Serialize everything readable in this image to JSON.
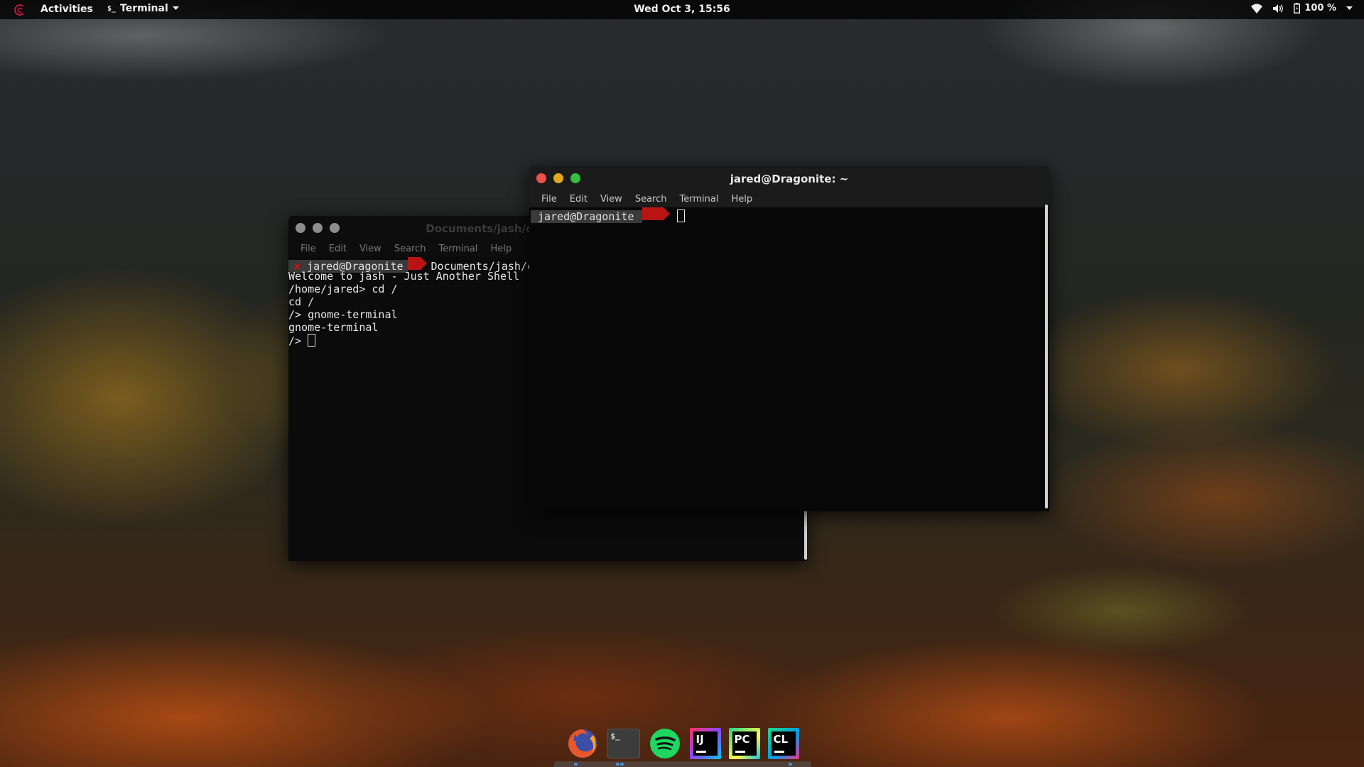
{
  "topbar": {
    "activities": "Activities",
    "app_menu": "Terminal",
    "clock": "Wed Oct  3, 15:56",
    "battery": "100 %",
    "icons": [
      "debian-logo-icon",
      "wifi-icon",
      "volume-icon",
      "battery-icon",
      "chevron-down-icon"
    ]
  },
  "back_window": {
    "title": "Documents/jash/cmake-build-debug/jash",
    "menu": [
      "File",
      "Edit",
      "View",
      "Search",
      "Terminal",
      "Help"
    ],
    "prompt": {
      "status": "✘",
      "user_host": "jared@Dragonite",
      "path": "Documents/jash/cmake-build-debug/jash"
    },
    "lines": [
      "Welcome to jash - Just Another Shell",
      "/home/jared> cd /",
      "cd /",
      "/> gnome-terminal",
      "gnome-terminal",
      "/> "
    ]
  },
  "front_window": {
    "title": "jared@Dragonite: ~",
    "menu": [
      "File",
      "Edit",
      "View",
      "Search",
      "Terminal",
      "Help"
    ],
    "prompt": {
      "user_host": "jared@Dragonite"
    }
  },
  "dock": {
    "apps": [
      {
        "name": "Firefox",
        "icon": "firefox-icon"
      },
      {
        "name": "Terminal",
        "icon": "terminal-icon",
        "label": "$_"
      },
      {
        "name": "Spotify",
        "icon": "spotify-icon"
      },
      {
        "name": "IntelliJ IDEA",
        "icon": "intellij-icon",
        "label": "IJ"
      },
      {
        "name": "PyCharm",
        "icon": "pycharm-icon",
        "label": "PC"
      },
      {
        "name": "CLion",
        "icon": "clion-icon",
        "label": "CL"
      }
    ]
  },
  "colors": {
    "powerline_red": "#b81414",
    "powerline_dark": "#3a3a3a",
    "mac_close": "#f0504a",
    "mac_min": "#e5a91f",
    "mac_max": "#34c03f"
  }
}
